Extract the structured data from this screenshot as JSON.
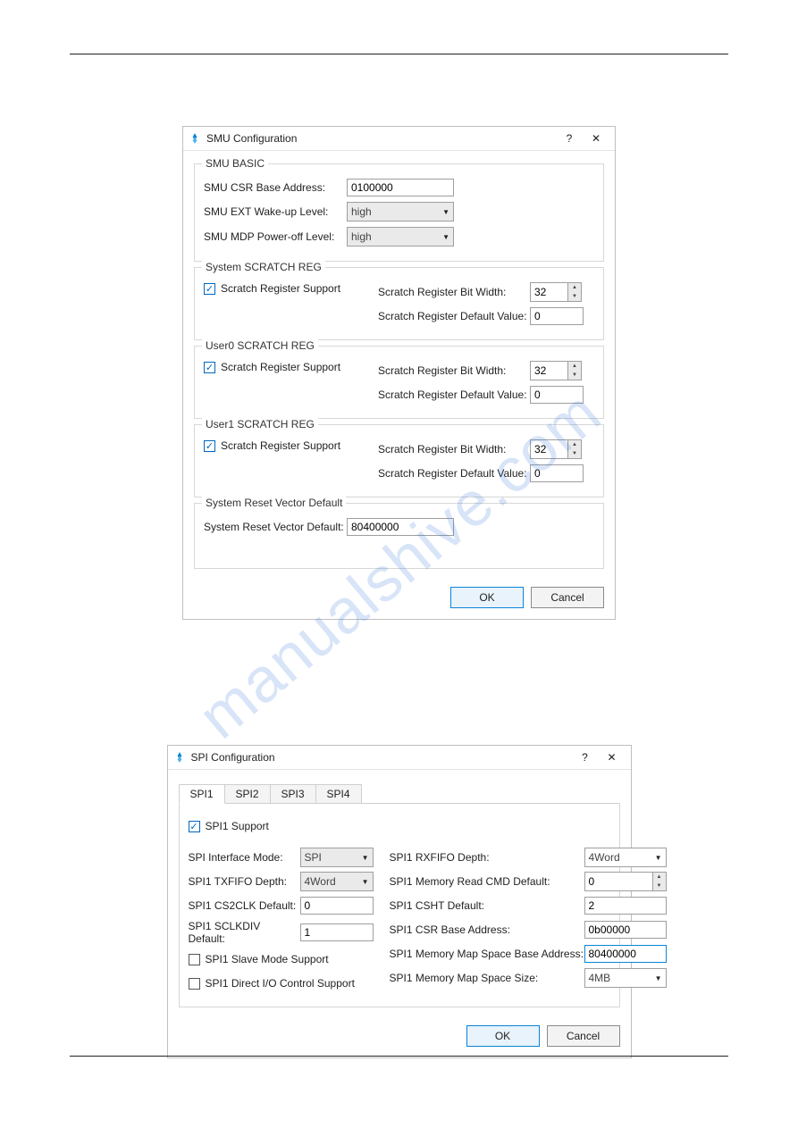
{
  "watermark": "manualshive.com",
  "smu": {
    "title": "SMU Configuration",
    "help_symbol": "?",
    "close_symbol": "✕",
    "basic": {
      "legend": "SMU BASIC",
      "csr_label": "SMU CSR Base Address:",
      "csr_value": "0100000",
      "ext_label": "SMU EXT Wake-up Level:",
      "ext_value": "high",
      "mdp_label": "SMU MDP Power-off Level:",
      "mdp_value": "high"
    },
    "sys_scratch": {
      "legend": "System SCRATCH REG",
      "support_label": "Scratch Register Support",
      "bitwidth_label": "Scratch Register Bit Width:",
      "bitwidth_value": "32",
      "default_label": "Scratch Register Default Value:",
      "default_value": "0"
    },
    "user0_scratch": {
      "legend": "User0 SCRATCH REG",
      "support_label": "Scratch Register Support",
      "bitwidth_label": "Scratch Register Bit Width:",
      "bitwidth_value": "32",
      "default_label": "Scratch Register Default Value:",
      "default_value": "0"
    },
    "user1_scratch": {
      "legend": "User1 SCRATCH REG",
      "support_label": "Scratch Register Support",
      "bitwidth_label": "Scratch Register Bit Width:",
      "bitwidth_value": "32",
      "default_label": "Scratch Register Default Value:",
      "default_value": "0"
    },
    "reset": {
      "legend": "System Reset Vector Default",
      "label": "System Reset Vector Default:",
      "value": "80400000"
    },
    "ok": "OK",
    "cancel": "Cancel"
  },
  "spi": {
    "title": "SPI Configuration",
    "help_symbol": "?",
    "close_symbol": "✕",
    "tabs": [
      "SPI1",
      "SPI2",
      "SPI3",
      "SPI4"
    ],
    "support_label": "SPI1 Support",
    "left": {
      "if_mode_label": "SPI Interface Mode:",
      "if_mode_value": "SPI",
      "txfifo_label": "SPI1 TXFIFO Depth:",
      "txfifo_value": "4Word",
      "cs2clk_label": "SPI1 CS2CLK Default:",
      "cs2clk_value": "0",
      "sclkdiv_label": "SPI1 SCLKDIV Default:",
      "sclkdiv_value": "1",
      "slave_label": "SPI1 Slave Mode Support",
      "dio_label": "SPI1 Direct I/O Control Support"
    },
    "right": {
      "rxfifo_label": "SPI1 RXFIFO Depth:",
      "rxfifo_value": "4Word",
      "memrd_label": "SPI1 Memory Read CMD Default:",
      "memrd_value": "0",
      "csht_label": "SPI1 CSHT Default:",
      "csht_value": "2",
      "csr_label": "SPI1 CSR Base Address:",
      "csr_value": "0b00000",
      "mmbase_label": "SPI1 Memory Map Space Base Address:",
      "mmbase_value": "80400000",
      "mmsize_label": "SPI1 Memory Map Space Size:",
      "mmsize_value": "4MB"
    },
    "ok": "OK",
    "cancel": "Cancel"
  }
}
